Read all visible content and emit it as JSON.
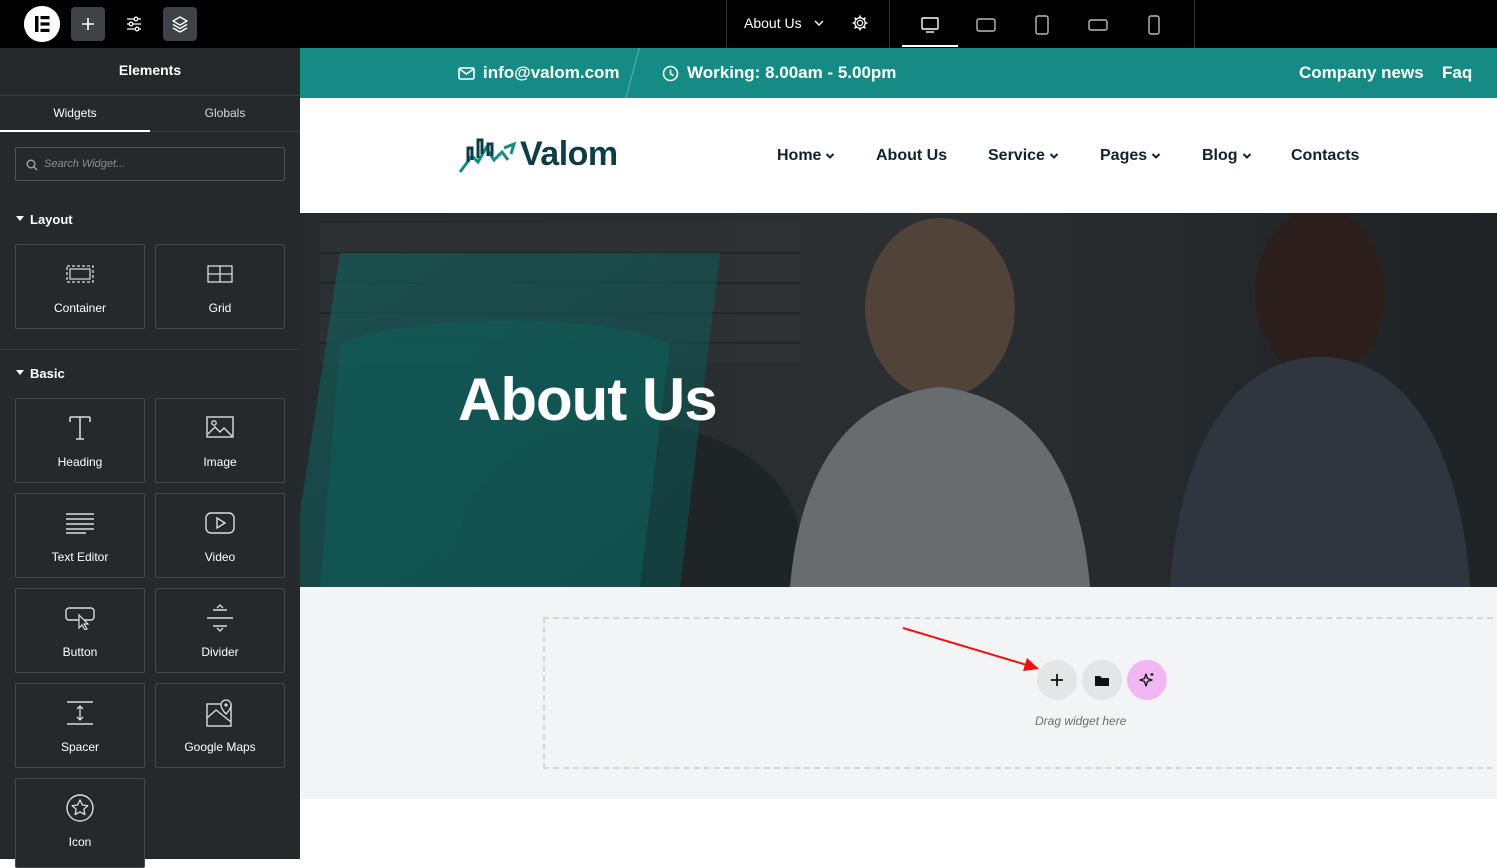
{
  "topbar": {
    "page_name": "About Us",
    "icons": [
      "elementor-logo-icon",
      "add-element-icon",
      "site-settings-icon",
      "structure-icon"
    ],
    "devices": [
      "desktop-icon",
      "laptop-icon",
      "tablet-icon",
      "tablet-landscape-icon",
      "mobile-icon"
    ],
    "active_device": "desktop"
  },
  "sidebar": {
    "title": "Elements",
    "tabs": [
      "Widgets",
      "Globals"
    ],
    "search_placeholder": "Search Widget...",
    "sections": [
      {
        "title": "Layout",
        "widgets": [
          {
            "label": "Container",
            "icon": "container-icon"
          },
          {
            "label": "Grid",
            "icon": "grid-icon"
          }
        ]
      },
      {
        "title": "Basic",
        "widgets": [
          {
            "label": "Heading",
            "icon": "heading-icon"
          },
          {
            "label": "Image",
            "icon": "image-icon"
          },
          {
            "label": "Text Editor",
            "icon": "text-editor-icon"
          },
          {
            "label": "Video",
            "icon": "video-icon"
          },
          {
            "label": "Button",
            "icon": "button-icon"
          },
          {
            "label": "Divider",
            "icon": "divider-icon"
          },
          {
            "label": "Spacer",
            "icon": "spacer-icon"
          },
          {
            "label": "Google Maps",
            "icon": "google-maps-icon"
          },
          {
            "label": "Icon",
            "icon": "star-icon"
          }
        ]
      }
    ]
  },
  "site": {
    "accent": "#148b84",
    "email": "info@valom.com",
    "hours": "Working: 8.00am - 5.00pm",
    "top_links": [
      "Company news",
      "Faq"
    ],
    "brand": "Valom",
    "nav": [
      "Home",
      "About Us",
      "Service",
      "Pages",
      "Blog",
      "Contacts"
    ],
    "hero_title": "About Us"
  },
  "canvas": {
    "drop_text": "Drag widget here",
    "buttons": [
      "add-section-icon",
      "template-library-icon",
      "ai-sparkle-icon"
    ]
  }
}
